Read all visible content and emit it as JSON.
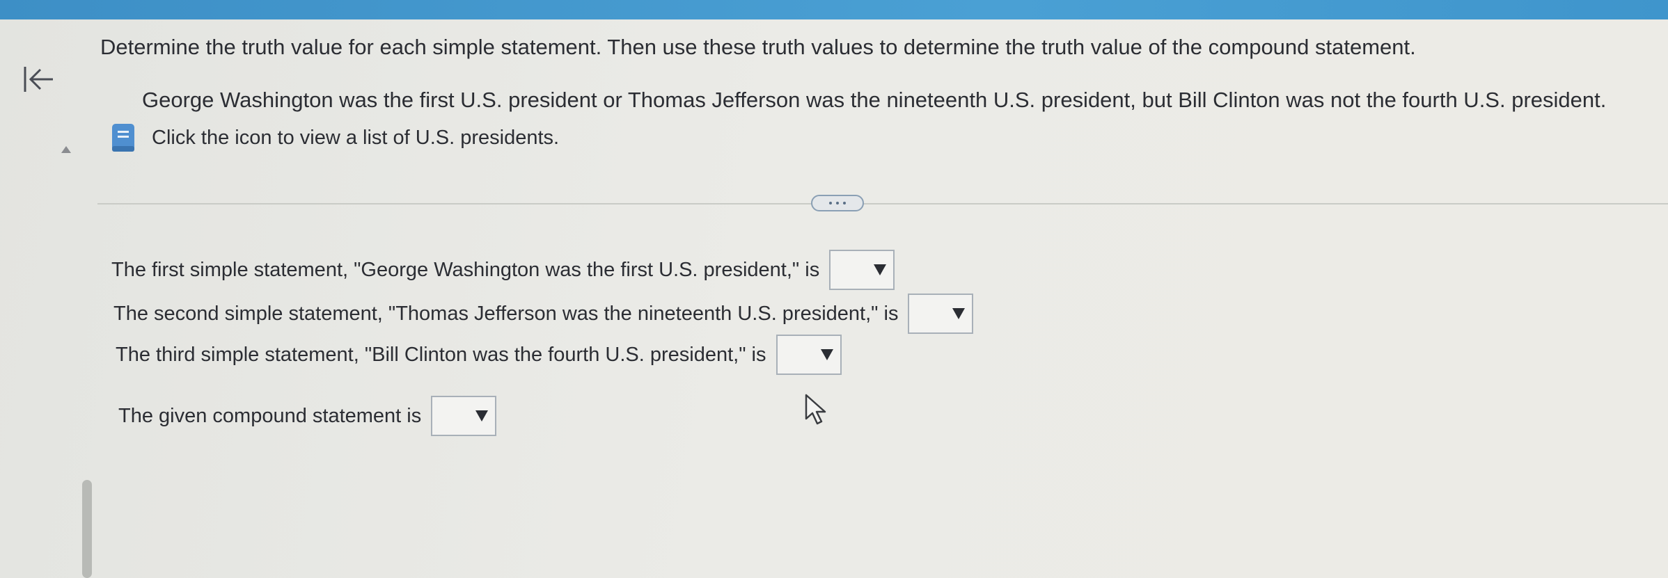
{
  "header": {
    "instructions": "Determine the truth value for each simple statement. Then use these truth values to determine the truth value of the compound statement."
  },
  "problem": {
    "statement": "George Washington was the first U.S. president or Thomas Jefferson was the nineteenth U.S. president, but Bill Clinton was not the fourth U.S. president.",
    "help_text": "Click the icon to view a list of U.S. presidents."
  },
  "questions": [
    {
      "label": "The first simple statement, \"George Washington was the first U.S. president,\" is",
      "selected": ""
    },
    {
      "label": "The second simple statement, \"Thomas Jefferson was the nineteenth U.S. president,\" is",
      "selected": ""
    },
    {
      "label": "The third simple statement, \"Bill Clinton was the fourth U.S. president,\" is",
      "selected": ""
    },
    {
      "label": "The given compound statement is",
      "selected": ""
    }
  ],
  "icons": {
    "back": "back-arrow-icon",
    "reference": "book-icon",
    "cursor": "mouse-pointer-icon"
  },
  "colors": {
    "topbar": "#4aa0d4",
    "icon_blue": "#4f8fd0",
    "text": "#2b2d33"
  }
}
